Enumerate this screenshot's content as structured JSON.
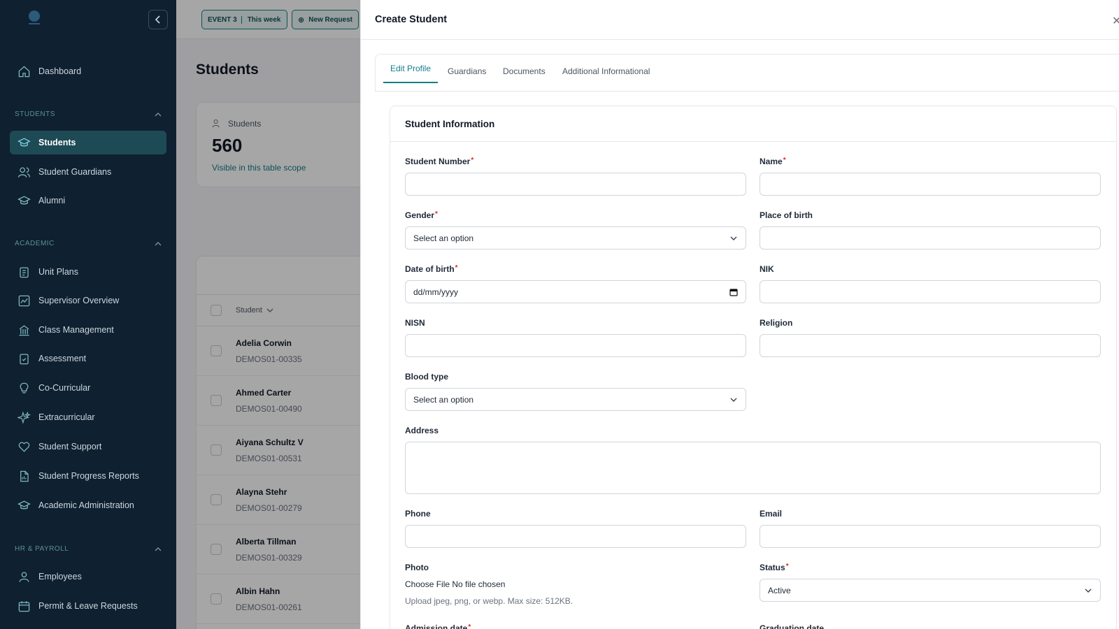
{
  "sidebar": {
    "sections": [
      {
        "label": "STUDENTS"
      },
      {
        "label": "ACADEMIC"
      },
      {
        "label": "HR & PAYROLL"
      }
    ],
    "items": [
      {
        "label": "Dashboard",
        "icon": "home-icon"
      },
      {
        "label": "Students",
        "icon": "graduation-cap-icon",
        "active": true
      },
      {
        "label": "Student Guardians",
        "icon": "users-icon"
      },
      {
        "label": "Alumni",
        "icon": "graduation-cap-icon"
      },
      {
        "label": "Unit Plans",
        "icon": "clipboard-icon"
      },
      {
        "label": "Supervisor Overview",
        "icon": "chart-icon"
      },
      {
        "label": "Class Management",
        "icon": "building-icon"
      },
      {
        "label": "Assessment",
        "icon": "clipboard-check-icon"
      },
      {
        "label": "Co-Curricular",
        "icon": "lightbulb-icon"
      },
      {
        "label": "Extracurricular",
        "icon": "sparkles-icon"
      },
      {
        "label": "Student Support",
        "icon": "heart-icon"
      },
      {
        "label": "Student Progress Reports",
        "icon": "file-chart-icon"
      },
      {
        "label": "Academic Administration",
        "icon": "graduation-cap-icon"
      },
      {
        "label": "Employees",
        "icon": "user-icon"
      },
      {
        "label": "Permit & Leave Requests",
        "icon": "calendar-icon"
      }
    ]
  },
  "topbar": {
    "event_tag": "EVENT 3",
    "event_label": "This week",
    "new_request": "New Request"
  },
  "main": {
    "title": "Students",
    "stat": {
      "label": "Students",
      "value": "560",
      "sub": "Visible in this table scope"
    },
    "table": {
      "column": "Student",
      "rows": [
        {
          "name": "Adelia Corwin",
          "code": "DEMOS01-00335"
        },
        {
          "name": "Ahmed Carter",
          "code": "DEMOS01-00490"
        },
        {
          "name": "Aiyana Schultz V",
          "code": "DEMOS01-00531"
        },
        {
          "name": "Alayna Stehr",
          "code": "DEMOS01-00279"
        },
        {
          "name": "Alberta Tillman",
          "code": "DEMOS01-00329"
        },
        {
          "name": "Albin Hahn",
          "code": "DEMOS01-00261"
        }
      ]
    }
  },
  "modal": {
    "title": "Create Student",
    "tabs": [
      "Edit Profile",
      "Guardians",
      "Documents",
      "Additional Informational"
    ],
    "section_title": "Student Information",
    "fields": {
      "student_number": "Student Number",
      "name": "Name",
      "gender": "Gender",
      "gender_value": "Select an option",
      "place_of_birth": "Place of birth",
      "date_of_birth": "Date of birth",
      "date_placeholder": "dd/mm/yyyy",
      "nik": "NIK",
      "nisn": "NISN",
      "religion": "Religion",
      "blood_type": "Blood type",
      "blood_type_value": "Select an option",
      "address": "Address",
      "phone": "Phone",
      "email": "Email",
      "photo": "Photo",
      "photo_button": "Choose File",
      "photo_status": "No file chosen",
      "photo_help": "Upload jpeg, png, or webp. Max size: 512KB.",
      "status": "Status",
      "status_value": "Active",
      "admission_date": "Admission date",
      "graduation_date": "Graduation date"
    }
  },
  "colors": {
    "sidebar_bg": "#0f2030",
    "accent": "#167d88",
    "required": "#dc2626"
  }
}
